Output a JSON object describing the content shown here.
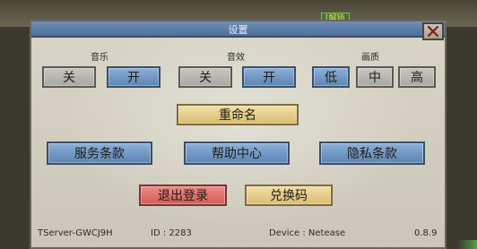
{
  "top_tag": "[解锁",
  "dialog": {
    "title": "设置"
  },
  "labels": {
    "music": "音乐",
    "sound": "音效",
    "quality": "画质"
  },
  "toggles": {
    "music_off": "关",
    "music_on": "开",
    "sound_off": "关",
    "sound_on": "开",
    "quality_low": "低",
    "quality_mid": "中",
    "quality_high": "高"
  },
  "buttons": {
    "rename": "重命名",
    "terms": "服务条款",
    "help": "帮助中心",
    "privacy": "隐私条款",
    "logout": "退出登录",
    "redeem": "兑换码"
  },
  "footer": {
    "server": "TServer-GWCJ9H",
    "id": "ID : 2283",
    "device": "Device : Netease",
    "version": "0.8.9"
  },
  "icons": {
    "close": "close-icon"
  },
  "colors": {
    "selected": "#5c84b2",
    "unselected": "#a8a7a1",
    "gold": "#d9bd72",
    "red": "#d25b57"
  }
}
